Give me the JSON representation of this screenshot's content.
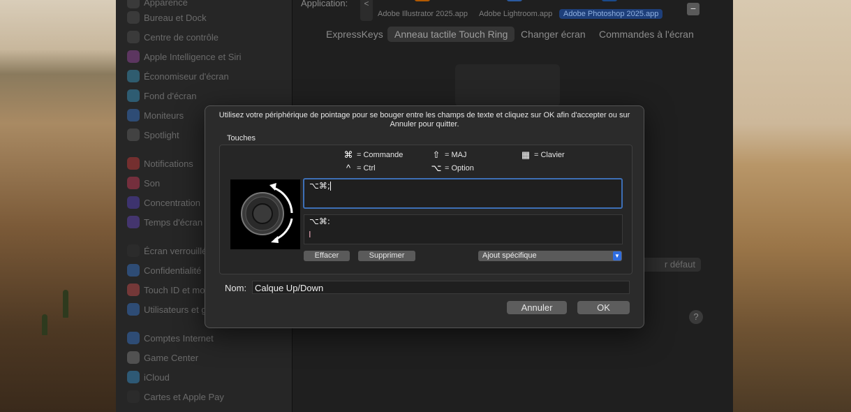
{
  "sidebar": {
    "items": [
      {
        "label": "Apparence",
        "color": "#555"
      },
      {
        "label": "Bureau et Dock",
        "color": "#555"
      },
      {
        "label": "Centre de contrôle",
        "color": "#555"
      },
      {
        "label": "Apple Intelligence et Siri",
        "color": "#a04ba8"
      },
      {
        "label": "Économiseur d'écran",
        "color": "#3ba0c9"
      },
      {
        "label": "Fond d'écran",
        "color": "#3aa0d0"
      },
      {
        "label": "Moniteurs",
        "color": "#3a7dd6"
      },
      {
        "label": "Spotlight",
        "color": "#666"
      },
      {
        "label": "Notifications",
        "color": "#d43b3b"
      },
      {
        "label": "Son",
        "color": "#d43b5a"
      },
      {
        "label": "Concentration",
        "color": "#5a45c8"
      },
      {
        "label": "Temps d'écran",
        "color": "#6a4ac8"
      },
      {
        "label": "Écran verrouillé",
        "color": "#333"
      },
      {
        "label": "Confidentialité",
        "color": "#3a7dd6"
      },
      {
        "label": "Touch ID et mot de passe",
        "color": "#d45050"
      },
      {
        "label": "Utilisateurs et groupes",
        "color": "#3a7dd6"
      },
      {
        "label": "Comptes Internet",
        "color": "#3a7dd6"
      },
      {
        "label": "Game Center",
        "color": "#888"
      },
      {
        "label": "iCloud",
        "color": "#3a9ad6"
      },
      {
        "label": "Cartes et Apple Pay",
        "color": "#333"
      }
    ]
  },
  "main": {
    "application_label": "Application:",
    "back_label": "<",
    "apps": [
      {
        "name": "Adobe Illustrator 2025.app",
        "color": "#b35a00"
      },
      {
        "name": "Adobe Lightroom.app",
        "color": "#2a5aa0"
      },
      {
        "name": "Adobe Photoshop 2025.app",
        "color": "#1a4a8a"
      }
    ],
    "remove_label": "−",
    "tabs": [
      "ExpressKeys",
      "Anneau tactile Touch Ring",
      "Changer écran",
      "Commandes à l'écran"
    ],
    "default_button": "r défaut",
    "help_label": "?"
  },
  "dialog": {
    "instructions": "Utilisez votre périphérique de pointage pour se bouger entre les champs de texte et cliquez sur OK afin d'accepter ou sur Annuler pour quitter.",
    "group_title": "Touches",
    "legend": [
      {
        "symbol": "⌘",
        "text": "= Commande"
      },
      {
        "symbol": "⇧",
        "text": "= MAJ"
      },
      {
        "symbol": "▦",
        "text": "= Clavier"
      },
      {
        "symbol": "^",
        "text": "= Ctrl"
      },
      {
        "symbol": "⌥",
        "text": "= Option"
      }
    ],
    "field_clockwise": "⌥⌘;",
    "field_counter": "⌥⌘:",
    "clear_button": "Effacer",
    "delete_button": "Supprimer",
    "special_select": "Ajout spécifique",
    "name_label": "Nom:",
    "name_value": "Calque Up/Down",
    "cancel_button": "Annuler",
    "ok_button": "OK"
  }
}
